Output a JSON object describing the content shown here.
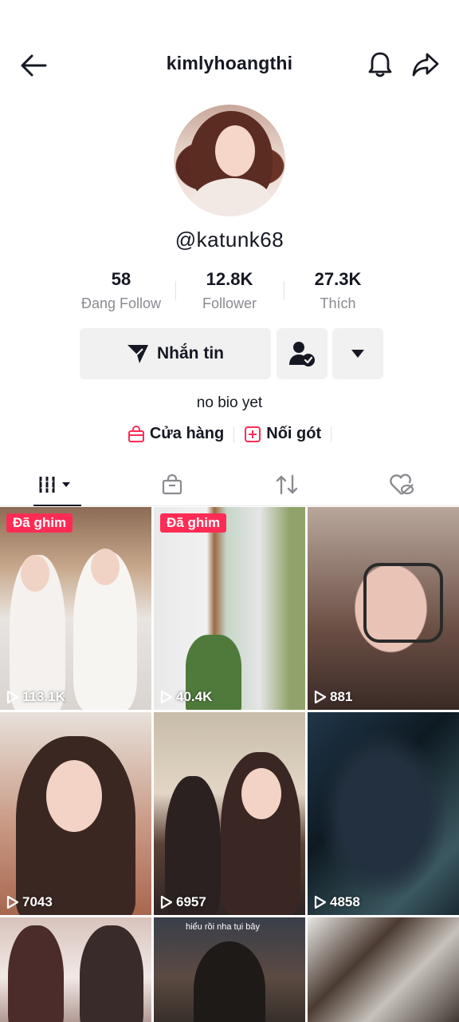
{
  "header": {
    "title": "kimlyhoangthi"
  },
  "profile": {
    "handle": "@katunk68",
    "bio": "no bio yet"
  },
  "stats": [
    {
      "value": "58",
      "label": "Đang Follow"
    },
    {
      "value": "12.8K",
      "label": "Follower"
    },
    {
      "value": "27.3K",
      "label": "Thích"
    }
  ],
  "actions": {
    "message_label": "Nhắn tin"
  },
  "links": [
    {
      "label": "Cửa hàng",
      "icon": "shopping-bag-icon"
    },
    {
      "label": "Nối gót",
      "icon": "add-box-icon"
    }
  ],
  "tabs": [
    {
      "name": "videos-grid-icon",
      "active": true
    },
    {
      "name": "shop-bag-icon",
      "active": false
    },
    {
      "name": "repost-icon",
      "active": false
    },
    {
      "name": "liked-hidden-icon",
      "active": false
    }
  ],
  "videos": [
    {
      "views": "113.1K",
      "pinned": true,
      "pin_label": "Đã ghim"
    },
    {
      "views": "40.4K",
      "pinned": true,
      "pin_label": "Đã ghim"
    },
    {
      "views": "881",
      "pinned": false
    },
    {
      "views": "7043",
      "pinned": false
    },
    {
      "views": "6957",
      "pinned": false
    },
    {
      "views": "4858",
      "pinned": false
    },
    {
      "views": "",
      "pinned": false
    },
    {
      "views": "",
      "pinned": false,
      "caption": "hiểu rồi nha tụi bây"
    },
    {
      "views": "",
      "pinned": false
    }
  ],
  "colors": {
    "accent": "#fe2c55",
    "text": "#161823",
    "muted": "#8a8b91",
    "button_bg": "#f1f1f2"
  }
}
